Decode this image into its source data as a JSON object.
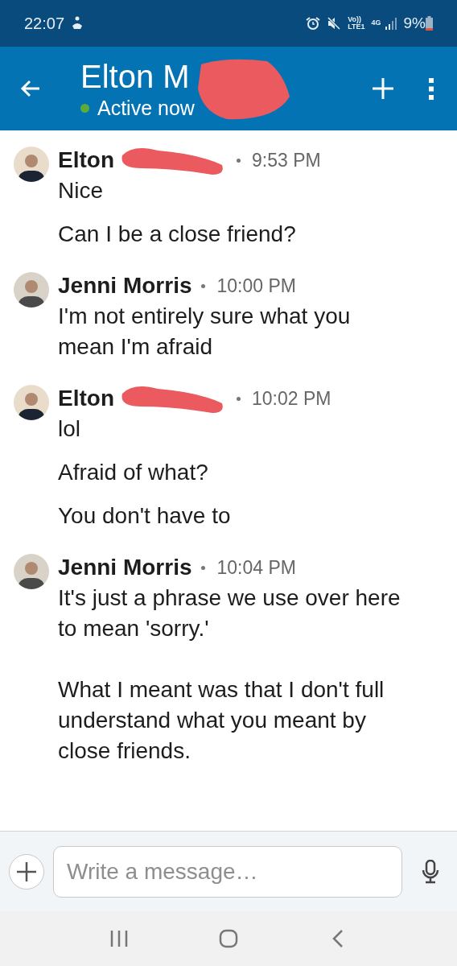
{
  "status_bar": {
    "time": "22:07",
    "volte": "Vo))",
    "lte": "LTE1",
    "data": "4G",
    "battery": "9%"
  },
  "header": {
    "title": "Elton M",
    "presence": "Active now",
    "online": true,
    "redacted": true
  },
  "messages": [
    {
      "sender": "Elton",
      "redacted": true,
      "time": "9:53 PM",
      "texts": [
        "Nice",
        "Can I be a close friend?"
      ]
    },
    {
      "sender": "Jenni Morris",
      "redacted": false,
      "time": "10:00 PM",
      "texts": [
        "I'm not entirely sure what you mean I'm afraid"
      ]
    },
    {
      "sender": "Elton",
      "redacted": true,
      "time": "10:02 PM",
      "texts": [
        "lol",
        "Afraid of what?",
        "You don't have to"
      ]
    },
    {
      "sender": "Jenni Morris",
      "redacted": false,
      "time": "10:04 PM",
      "texts": [
        "It's just a phrase we use over here to mean 'sorry.'\n\nWhat I meant was that I don't full understand what you meant by close friends."
      ]
    }
  ],
  "composer": {
    "placeholder": "Write a message…"
  }
}
